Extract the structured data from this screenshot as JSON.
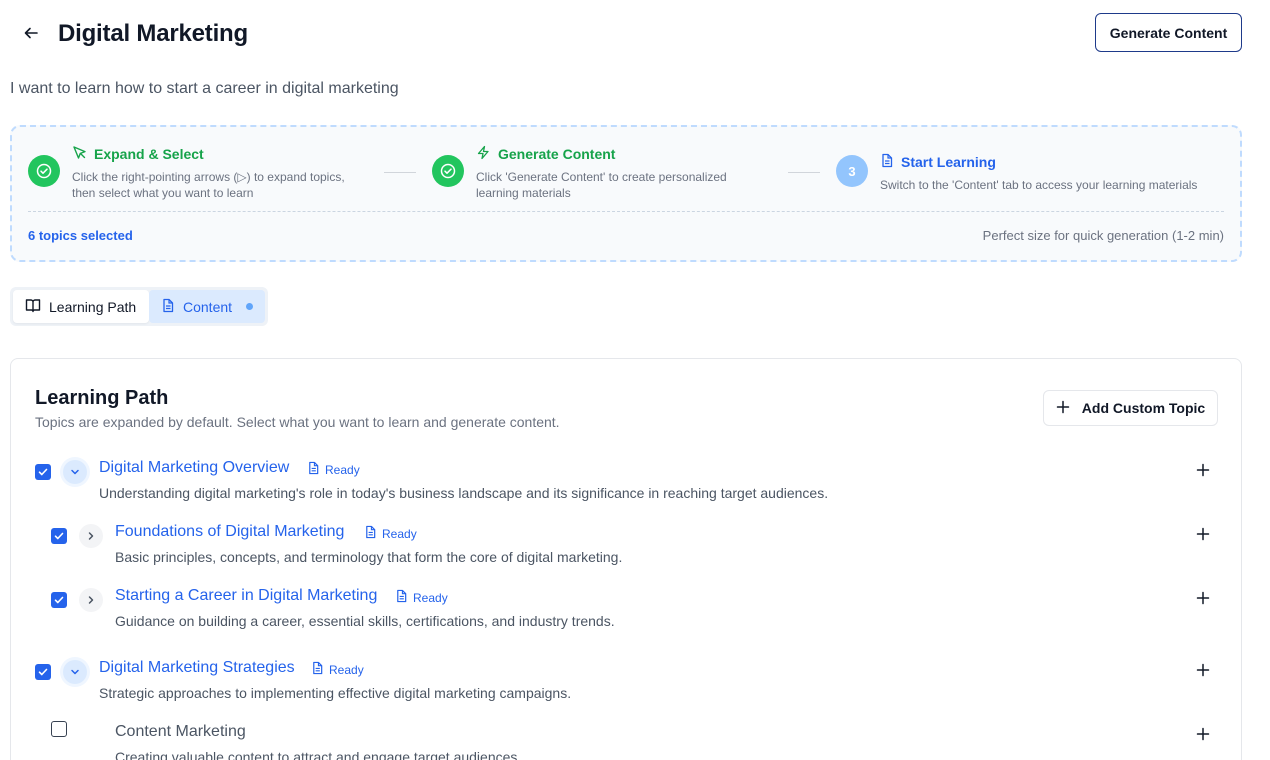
{
  "header": {
    "title": "Digital Marketing",
    "generate_button": "Generate Content"
  },
  "subtitle": "I want to learn how to start a career in digital marketing",
  "steps": [
    {
      "title": "Expand & Select",
      "desc_line1": "Click the right-pointing arrows (▷) to expand topics,",
      "desc_line2": "then select what you want to learn",
      "status": "done",
      "icon": "cursor-pointer-icon"
    },
    {
      "title": "Generate Content",
      "desc_line1": "Click 'Generate Content' to create personalized",
      "desc_line2": "learning materials",
      "status": "done",
      "icon": "lightning-icon"
    },
    {
      "title": "Start Learning",
      "number": "3",
      "desc_line1": "Switch to the 'Content' tab to access your learning materials",
      "status": "pending",
      "icon": "document-icon"
    }
  ],
  "selection": {
    "count_text": "6 topics selected",
    "size_text": "Perfect size for quick generation (1-2 min)"
  },
  "tabs": [
    {
      "label": "Learning Path",
      "active": true,
      "icon": "book-icon"
    },
    {
      "label": "Content",
      "active": false,
      "icon": "document-icon"
    }
  ],
  "learning_path": {
    "title": "Learning Path",
    "subtitle": "Topics are expanded by default. Select what you want to learn and generate content.",
    "add_button": "Add Custom Topic",
    "topics": [
      {
        "title": "Digital Marketing Overview",
        "desc": "Understanding digital marketing's role in today's business landscape and its significance in reaching target audiences.",
        "status": "Ready",
        "checked": true,
        "expanded": true,
        "level": 0
      },
      {
        "title": "Foundations of Digital Marketing",
        "desc": "Basic principles, concepts, and terminology that form the core of digital marketing.",
        "status": "Ready",
        "checked": true,
        "expanded": false,
        "level": 1
      },
      {
        "title": "Starting a Career in Digital Marketing",
        "desc": "Guidance on building a career, essential skills, certifications, and industry trends.",
        "status": "Ready",
        "checked": true,
        "expanded": false,
        "level": 1
      },
      {
        "title": "Digital Marketing Strategies",
        "desc": "Strategic approaches to implementing effective digital marketing campaigns.",
        "status": "Ready",
        "checked": true,
        "expanded": true,
        "level": 0
      },
      {
        "title": "Content Marketing",
        "desc": "Creating valuable content to attract and engage target audiences.",
        "checked": false,
        "level": 1
      }
    ]
  },
  "colors": {
    "primary": "#2563eb",
    "success": "#22c55e",
    "pending": "#93c5fd"
  }
}
